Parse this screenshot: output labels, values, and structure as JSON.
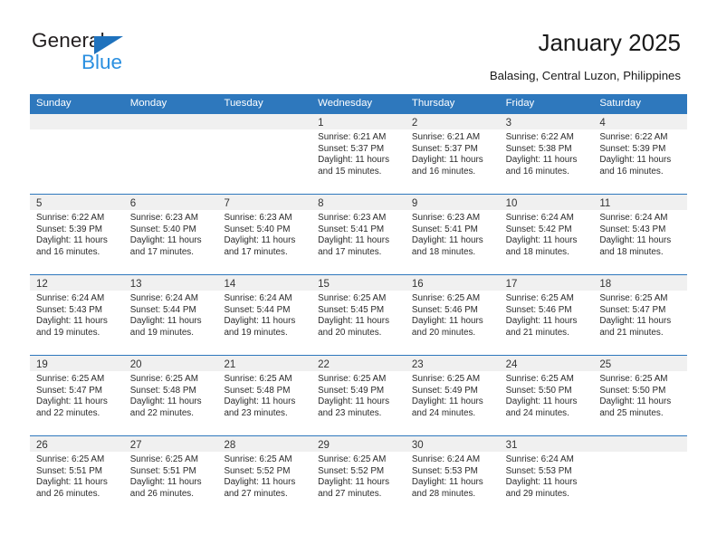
{
  "brand": {
    "name_part1": "General",
    "name_part2": "Blue",
    "triangle_color": "#1f72bd",
    "blue_text_color": "#2a8fe0"
  },
  "header": {
    "title": "January 2025",
    "subtitle": "Balasing, Central Luzon, Philippines"
  },
  "theme": {
    "header_bar_color": "#2e78bd",
    "day_strip_color": "#f0f0f0",
    "row_border_color": "#2e78bd"
  },
  "weekdays": [
    "Sunday",
    "Monday",
    "Tuesday",
    "Wednesday",
    "Thursday",
    "Friday",
    "Saturday"
  ],
  "weeks": [
    [
      {
        "day": "",
        "empty": true
      },
      {
        "day": "",
        "empty": true
      },
      {
        "day": "",
        "empty": true
      },
      {
        "day": "1",
        "sunrise": "Sunrise: 6:21 AM",
        "sunset": "Sunset: 5:37 PM",
        "daylight1": "Daylight: 11 hours",
        "daylight2": "and 15 minutes."
      },
      {
        "day": "2",
        "sunrise": "Sunrise: 6:21 AM",
        "sunset": "Sunset: 5:37 PM",
        "daylight1": "Daylight: 11 hours",
        "daylight2": "and 16 minutes."
      },
      {
        "day": "3",
        "sunrise": "Sunrise: 6:22 AM",
        "sunset": "Sunset: 5:38 PM",
        "daylight1": "Daylight: 11 hours",
        "daylight2": "and 16 minutes."
      },
      {
        "day": "4",
        "sunrise": "Sunrise: 6:22 AM",
        "sunset": "Sunset: 5:39 PM",
        "daylight1": "Daylight: 11 hours",
        "daylight2": "and 16 minutes."
      }
    ],
    [
      {
        "day": "5",
        "sunrise": "Sunrise: 6:22 AM",
        "sunset": "Sunset: 5:39 PM",
        "daylight1": "Daylight: 11 hours",
        "daylight2": "and 16 minutes."
      },
      {
        "day": "6",
        "sunrise": "Sunrise: 6:23 AM",
        "sunset": "Sunset: 5:40 PM",
        "daylight1": "Daylight: 11 hours",
        "daylight2": "and 17 minutes."
      },
      {
        "day": "7",
        "sunrise": "Sunrise: 6:23 AM",
        "sunset": "Sunset: 5:40 PM",
        "daylight1": "Daylight: 11 hours",
        "daylight2": "and 17 minutes."
      },
      {
        "day": "8",
        "sunrise": "Sunrise: 6:23 AM",
        "sunset": "Sunset: 5:41 PM",
        "daylight1": "Daylight: 11 hours",
        "daylight2": "and 17 minutes."
      },
      {
        "day": "9",
        "sunrise": "Sunrise: 6:23 AM",
        "sunset": "Sunset: 5:41 PM",
        "daylight1": "Daylight: 11 hours",
        "daylight2": "and 18 minutes."
      },
      {
        "day": "10",
        "sunrise": "Sunrise: 6:24 AM",
        "sunset": "Sunset: 5:42 PM",
        "daylight1": "Daylight: 11 hours",
        "daylight2": "and 18 minutes."
      },
      {
        "day": "11",
        "sunrise": "Sunrise: 6:24 AM",
        "sunset": "Sunset: 5:43 PM",
        "daylight1": "Daylight: 11 hours",
        "daylight2": "and 18 minutes."
      }
    ],
    [
      {
        "day": "12",
        "sunrise": "Sunrise: 6:24 AM",
        "sunset": "Sunset: 5:43 PM",
        "daylight1": "Daylight: 11 hours",
        "daylight2": "and 19 minutes."
      },
      {
        "day": "13",
        "sunrise": "Sunrise: 6:24 AM",
        "sunset": "Sunset: 5:44 PM",
        "daylight1": "Daylight: 11 hours",
        "daylight2": "and 19 minutes."
      },
      {
        "day": "14",
        "sunrise": "Sunrise: 6:24 AM",
        "sunset": "Sunset: 5:44 PM",
        "daylight1": "Daylight: 11 hours",
        "daylight2": "and 19 minutes."
      },
      {
        "day": "15",
        "sunrise": "Sunrise: 6:25 AM",
        "sunset": "Sunset: 5:45 PM",
        "daylight1": "Daylight: 11 hours",
        "daylight2": "and 20 minutes."
      },
      {
        "day": "16",
        "sunrise": "Sunrise: 6:25 AM",
        "sunset": "Sunset: 5:46 PM",
        "daylight1": "Daylight: 11 hours",
        "daylight2": "and 20 minutes."
      },
      {
        "day": "17",
        "sunrise": "Sunrise: 6:25 AM",
        "sunset": "Sunset: 5:46 PM",
        "daylight1": "Daylight: 11 hours",
        "daylight2": "and 21 minutes."
      },
      {
        "day": "18",
        "sunrise": "Sunrise: 6:25 AM",
        "sunset": "Sunset: 5:47 PM",
        "daylight1": "Daylight: 11 hours",
        "daylight2": "and 21 minutes."
      }
    ],
    [
      {
        "day": "19",
        "sunrise": "Sunrise: 6:25 AM",
        "sunset": "Sunset: 5:47 PM",
        "daylight1": "Daylight: 11 hours",
        "daylight2": "and 22 minutes."
      },
      {
        "day": "20",
        "sunrise": "Sunrise: 6:25 AM",
        "sunset": "Sunset: 5:48 PM",
        "daylight1": "Daylight: 11 hours",
        "daylight2": "and 22 minutes."
      },
      {
        "day": "21",
        "sunrise": "Sunrise: 6:25 AM",
        "sunset": "Sunset: 5:48 PM",
        "daylight1": "Daylight: 11 hours",
        "daylight2": "and 23 minutes."
      },
      {
        "day": "22",
        "sunrise": "Sunrise: 6:25 AM",
        "sunset": "Sunset: 5:49 PM",
        "daylight1": "Daylight: 11 hours",
        "daylight2": "and 23 minutes."
      },
      {
        "day": "23",
        "sunrise": "Sunrise: 6:25 AM",
        "sunset": "Sunset: 5:49 PM",
        "daylight1": "Daylight: 11 hours",
        "daylight2": "and 24 minutes."
      },
      {
        "day": "24",
        "sunrise": "Sunrise: 6:25 AM",
        "sunset": "Sunset: 5:50 PM",
        "daylight1": "Daylight: 11 hours",
        "daylight2": "and 24 minutes."
      },
      {
        "day": "25",
        "sunrise": "Sunrise: 6:25 AM",
        "sunset": "Sunset: 5:50 PM",
        "daylight1": "Daylight: 11 hours",
        "daylight2": "and 25 minutes."
      }
    ],
    [
      {
        "day": "26",
        "sunrise": "Sunrise: 6:25 AM",
        "sunset": "Sunset: 5:51 PM",
        "daylight1": "Daylight: 11 hours",
        "daylight2": "and 26 minutes."
      },
      {
        "day": "27",
        "sunrise": "Sunrise: 6:25 AM",
        "sunset": "Sunset: 5:51 PM",
        "daylight1": "Daylight: 11 hours",
        "daylight2": "and 26 minutes."
      },
      {
        "day": "28",
        "sunrise": "Sunrise: 6:25 AM",
        "sunset": "Sunset: 5:52 PM",
        "daylight1": "Daylight: 11 hours",
        "daylight2": "and 27 minutes."
      },
      {
        "day": "29",
        "sunrise": "Sunrise: 6:25 AM",
        "sunset": "Sunset: 5:52 PM",
        "daylight1": "Daylight: 11 hours",
        "daylight2": "and 27 minutes."
      },
      {
        "day": "30",
        "sunrise": "Sunrise: 6:24 AM",
        "sunset": "Sunset: 5:53 PM",
        "daylight1": "Daylight: 11 hours",
        "daylight2": "and 28 minutes."
      },
      {
        "day": "31",
        "sunrise": "Sunrise: 6:24 AM",
        "sunset": "Sunset: 5:53 PM",
        "daylight1": "Daylight: 11 hours",
        "daylight2": "and 29 minutes."
      },
      {
        "day": "",
        "empty": true
      }
    ]
  ]
}
